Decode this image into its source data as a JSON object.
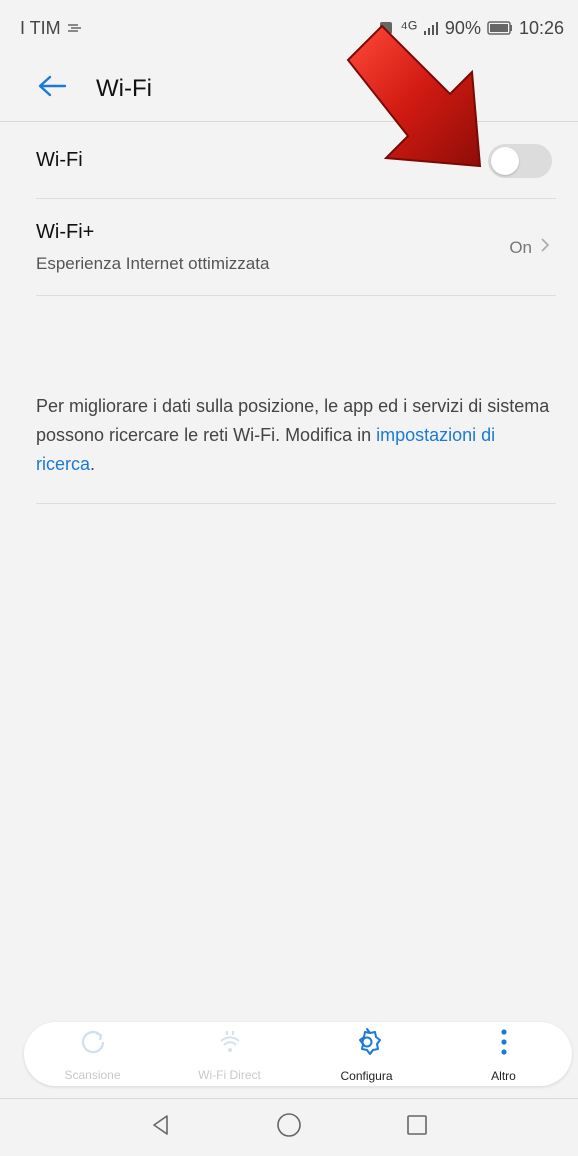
{
  "status_bar": {
    "carrier": "I TIM",
    "network": "⁴ᴳ",
    "battery": "90%",
    "time": "10:26"
  },
  "header": {
    "title": "Wi-Fi",
    "back_icon": "back-arrow-icon"
  },
  "settings": {
    "wifi": {
      "label": "Wi-Fi",
      "enabled": false
    },
    "wifi_plus": {
      "label": "Wi-Fi+",
      "subtitle": "Esperienza Internet ottimizzata",
      "value": "On"
    }
  },
  "info": {
    "text": "Per migliorare i dati sulla posizione, le app ed i servizi di sistema possono ricercare le reti Wi-Fi. Modifica in ",
    "link": "impostazioni di ricerca",
    "end": "."
  },
  "toolbar": {
    "items": [
      {
        "label": "Scansione",
        "icon": "refresh-icon",
        "enabled": false
      },
      {
        "label": "Wi-Fi Direct",
        "icon": "wifi-direct-icon",
        "enabled": false
      },
      {
        "label": "Configura",
        "icon": "gear-icon",
        "enabled": true
      },
      {
        "label": "Altro",
        "icon": "more-vertical-icon",
        "enabled": true
      }
    ]
  },
  "colors": {
    "accent": "#1a7ad6",
    "background": "#f3f3f3",
    "arrow": "#d11a12"
  }
}
